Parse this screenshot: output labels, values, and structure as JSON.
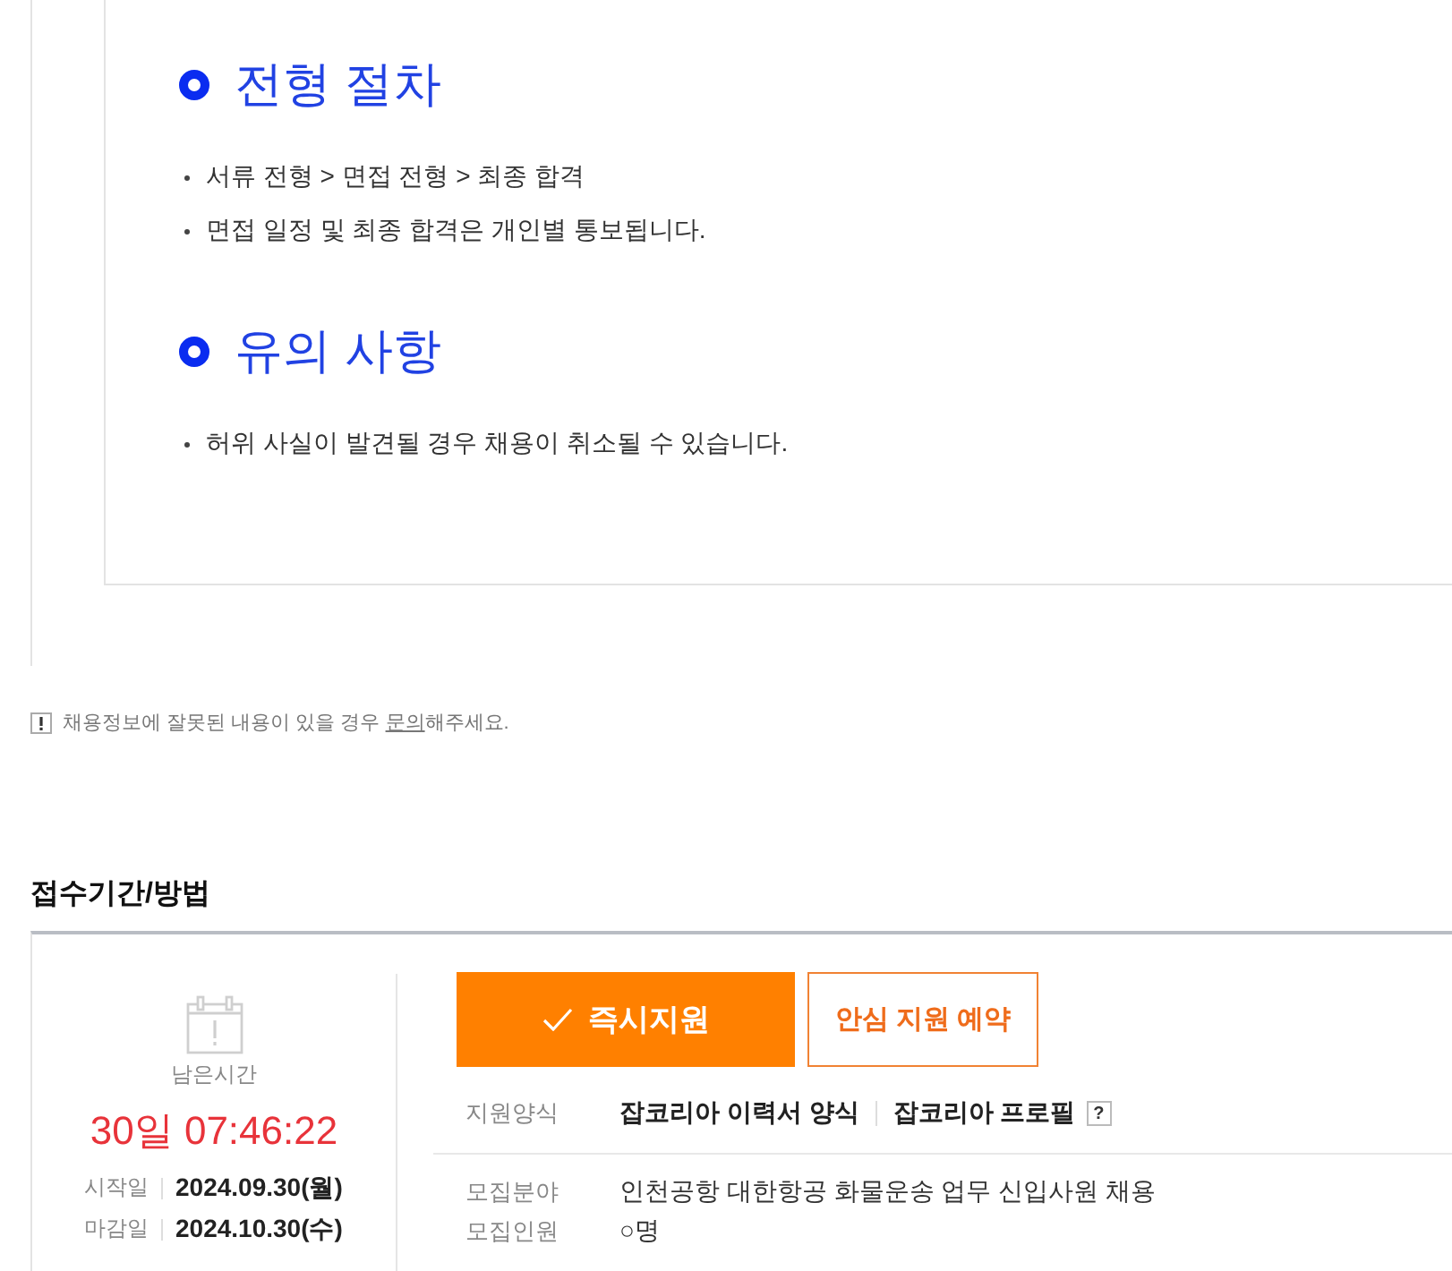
{
  "guide": {
    "sections": [
      {
        "heading": "전형 절차",
        "bullets": [
          "서류 전형 > 면접 전형 > 최종 합격",
          "면접 일정 및 최종 합격은 개인별 통보됩니다."
        ]
      },
      {
        "heading": "유의 사항",
        "bullets": [
          "허위 사실이 발견될 경우 채용이 취소될 수 있습니다."
        ]
      }
    ]
  },
  "notice": {
    "before": "채용정보에 잘못된 내용이 있을 경우 ",
    "link": "문의",
    "after": "해주세요."
  },
  "application": {
    "title": "접수기간/방법",
    "remaining_label": "남은시간",
    "remaining": "30일 07:46:22",
    "dates": [
      {
        "label": "시작일",
        "value": "2024.09.30(월)"
      },
      {
        "label": "마감일",
        "value": "2024.10.30(수)"
      }
    ],
    "buttons": [
      {
        "kind": "primary",
        "label": "즉시지원"
      },
      {
        "kind": "outline",
        "label": "안심 지원 예약"
      }
    ],
    "form": {
      "label": "지원양식",
      "options": [
        "잡코리아 이력서 양식",
        "잡코리아 프로필"
      ],
      "help": "?"
    },
    "details": [
      {
        "label": "모집분야",
        "value": "인천공항 대한항공 화물운송 업무 신입사원 채용"
      },
      {
        "label": "모집인원",
        "value": "○명"
      }
    ]
  }
}
